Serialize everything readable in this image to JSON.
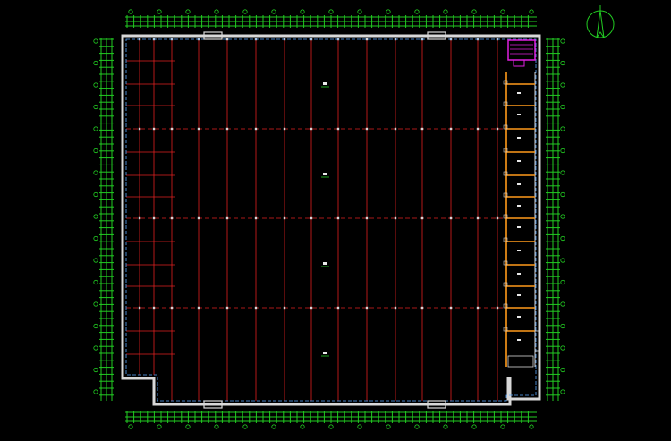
{
  "drawing": {
    "background": "#000000",
    "colors": {
      "wall": "#d8d8d8",
      "axis": "#e02020",
      "grid_dash": "#e02020",
      "dimension": "#22cc22",
      "room": "#ff9a1a",
      "highlight": "#e020e0",
      "text": "#e8e8e8",
      "north_arrow": "#22cc22"
    },
    "north_arrow_icon": "north-arrow-icon",
    "room_labels": [
      "",
      "",
      "",
      "",
      "",
      "",
      "",
      "",
      "",
      "",
      "",
      "",
      ""
    ],
    "hall_labels": [
      "",
      "",
      "",
      ""
    ]
  }
}
